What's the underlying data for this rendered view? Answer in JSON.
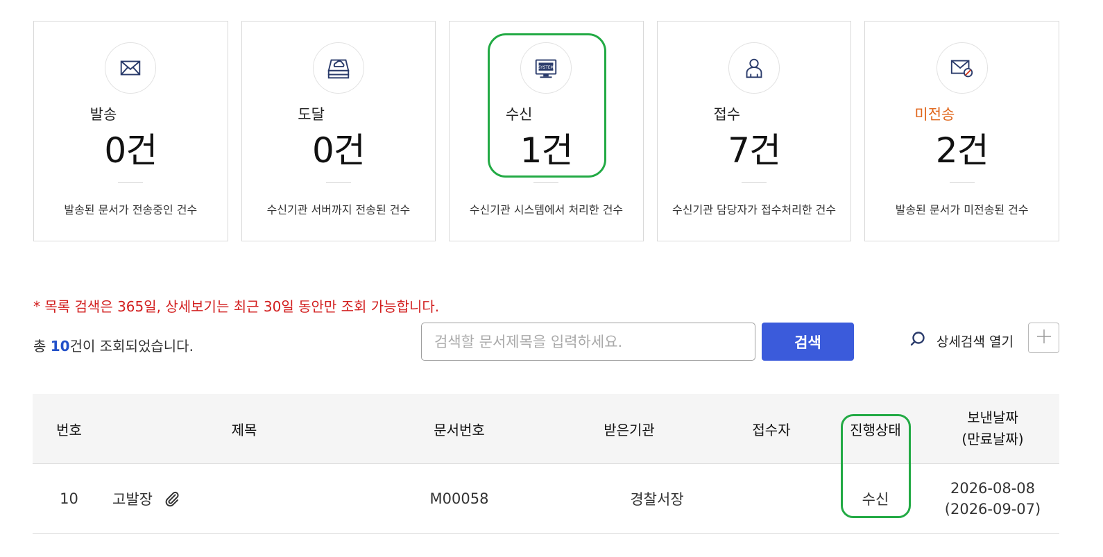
{
  "cards": [
    {
      "icon": "envelope-icon",
      "title": "발송",
      "count": "0건",
      "desc": "발송된 문서가 전송중인 건수"
    },
    {
      "icon": "cloud-server-icon",
      "title": "도달",
      "count": "0건",
      "desc": "수신기관 서버까지 전송된 건수"
    },
    {
      "icon": "system-monitor-icon",
      "title": "수신",
      "count": "1건",
      "desc": "수신기관 시스템에서 처리한 건수"
    },
    {
      "icon": "person-icon",
      "title": "접수",
      "count": "7건",
      "desc": "수신기관 담당자가 접수처리한 건수"
    },
    {
      "icon": "envelope-blocked-icon",
      "title": "미전송",
      "count": "2건",
      "desc": "발송된 문서가 미전송된 건수"
    }
  ],
  "notice": "* 목록 검색은 365일, 상세보기는 최근 30일 동안만 조회 가능합니다.",
  "total": {
    "prefix": "총 ",
    "count": "10",
    "suffix": "건이 조회되었습니다."
  },
  "search": {
    "placeholder": "검색할 문서제목을 입력하세요.",
    "value": "",
    "button_label": "검색"
  },
  "advanced_search": {
    "label": "상세검색 열기"
  },
  "table": {
    "headers": {
      "no": "번호",
      "title": "제목",
      "doc_no": "문서번호",
      "org": "받은기관",
      "receiver": "접수자",
      "status": "진행상태",
      "date_line1": "보낸날짜",
      "date_line2": "(만료날짜)"
    },
    "rows": [
      {
        "no": "10",
        "title": "고발장",
        "doc_no": "M00058",
        "org": "경찰서장",
        "receiver": "",
        "status": "수신",
        "sent_date": "2026-08-08",
        "expire_date": "(2026-09-07)"
      }
    ]
  },
  "colors": {
    "accent": "#3b5bdb",
    "warn": "#e0661b",
    "notice": "#d21e1e",
    "highlight": "#22aa44"
  }
}
